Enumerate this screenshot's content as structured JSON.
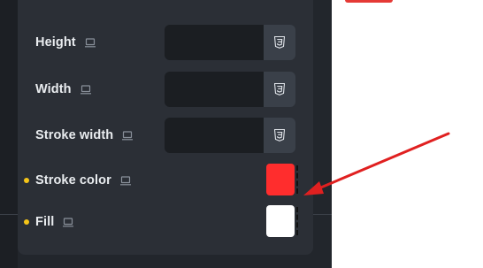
{
  "properties": {
    "height_label": "Height",
    "width_label": "Width",
    "stroke_width_label": "Stroke width",
    "stroke_color_label": "Stroke color",
    "fill_label": "Fill"
  },
  "inputs": {
    "height_value": "",
    "width_value": "",
    "stroke_width_value": ""
  },
  "colors": {
    "stroke_color": "#ff2d2d",
    "fill": "#ffffff",
    "annotation_arrow": "#e02020",
    "modified_dot": "#f5c518"
  },
  "icons": {
    "device": "desktop-icon",
    "css": "css3-icon"
  }
}
